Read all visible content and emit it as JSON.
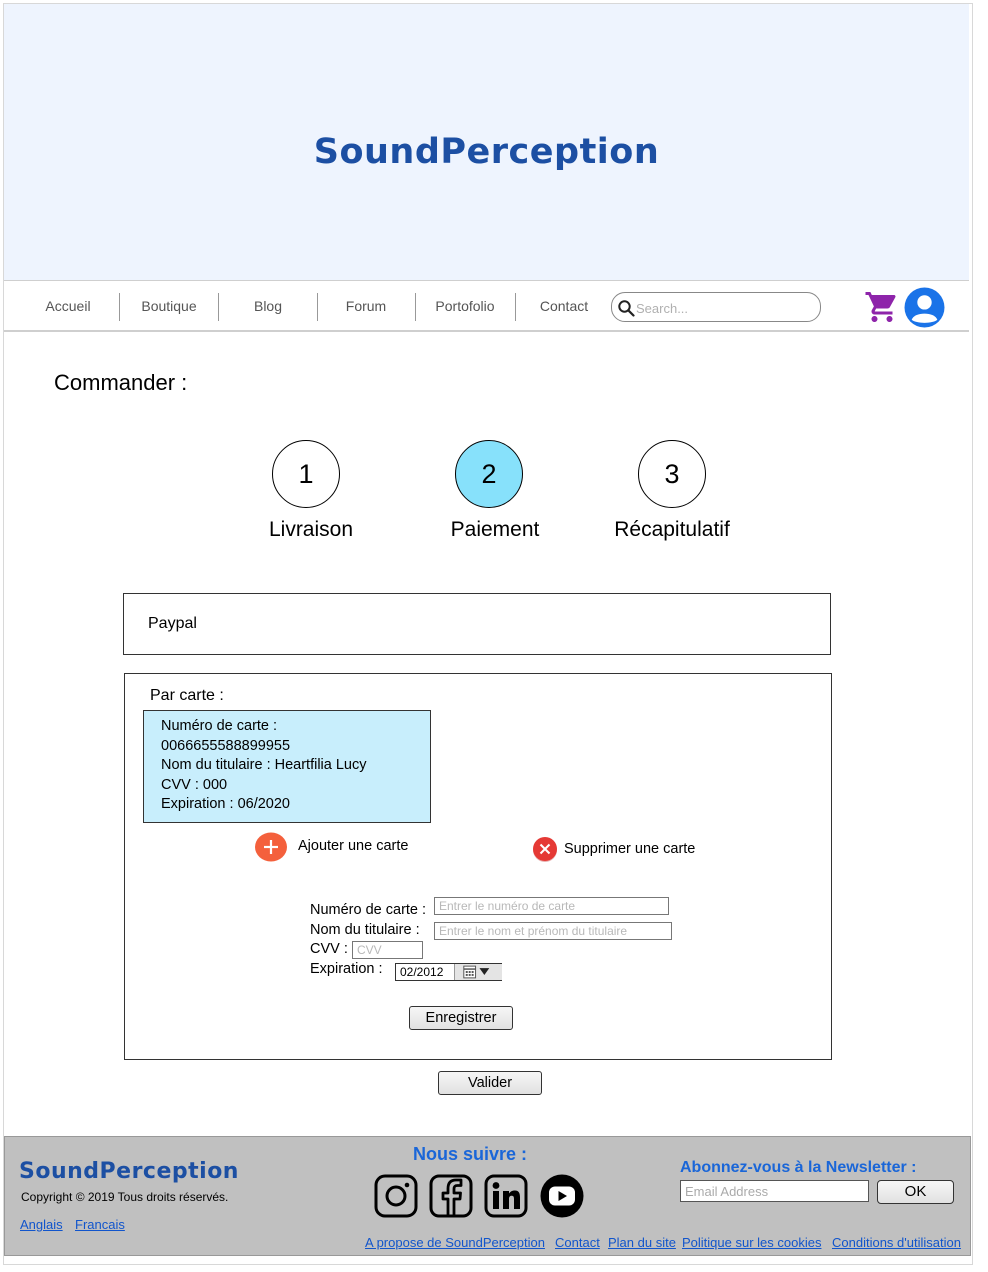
{
  "header": {
    "brand": "SoundPerception"
  },
  "nav": {
    "items": [
      "Accueil",
      "Boutique",
      "Blog",
      "Forum",
      "Portofolio",
      "Contact"
    ],
    "search_placeholder": "Search..."
  },
  "order": {
    "title": "Commander :",
    "steps": [
      {
        "number": "1",
        "label": "Livraison"
      },
      {
        "number": "2",
        "label": "Paiement"
      },
      {
        "number": "3",
        "label": "Récapitulatif"
      }
    ],
    "active_step": 2
  },
  "payment": {
    "paypal_label": "Paypal",
    "card_section_title": "Par carte :",
    "saved_card": {
      "number_label": "Numéro de carte :",
      "number": "0066655588899955",
      "holder": "Nom du titulaire : Heartfilia Lucy",
      "cvv": "CVV : 000",
      "expiration": "Expiration : 06/2020"
    },
    "add_card_label": "Ajouter une carte",
    "delete_card_label": "Supprimer une carte",
    "form": {
      "card_number_label": "Numéro de carte :",
      "card_number_placeholder": "Entrer le numéro de carte",
      "holder_label": "Nom du titulaire :",
      "holder_placeholder": "Entrer le nom et prénom du titulaire",
      "cvv_label": "CVV :",
      "cvv_placeholder": "CVV",
      "expiration_label": "Expiration :",
      "expiration_value": "02/2012"
    },
    "save_button": "Enregistrer",
    "validate_button": "Valider"
  },
  "footer": {
    "brand": "SoundPerception",
    "copyright": "Copyright © 2019 Tous droits réservés.",
    "languages": [
      "Anglais",
      "Francais"
    ],
    "follow_title": "Nous suivre :",
    "social_icons": [
      "instagram-icon",
      "facebook-icon",
      "linkedin-icon",
      "youtube-icon"
    ],
    "newsletter_title": "Abonnez-vous à la Newsletter :",
    "newsletter_placeholder": "Email Address",
    "ok_button": "OK",
    "links": [
      "A propose de SoundPerception",
      "Contact",
      "Plan du site",
      "Politique sur les cookies",
      "Conditions d'utilisation"
    ]
  },
  "colors": {
    "brand_blue": "#1c4fa3",
    "link_blue": "#1a66d8",
    "active_step": "#87e1fb",
    "saved_card_bg": "#c8eefc",
    "cart_purple": "#8e24aa",
    "add_orange": "#f4603c",
    "delete_red": "#e53935"
  }
}
